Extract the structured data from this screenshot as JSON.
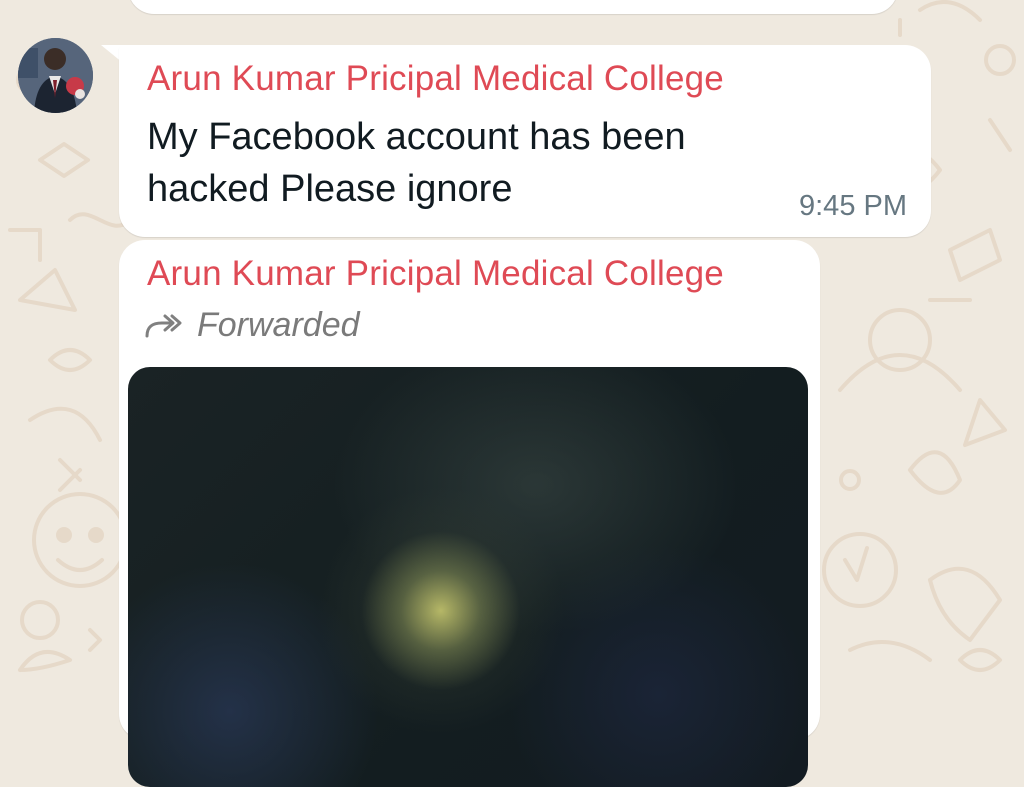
{
  "theme": {
    "wallpaper_color": "#efe9df",
    "bubble_color": "#ffffff",
    "sender_color": "#df4a55",
    "text_color": "#111b21",
    "timestamp_color": "#667781"
  },
  "messages": [
    {
      "sender": "Arun Kumar Pricipal Medical College",
      "text": "My Facebook account has been hacked Please ignore",
      "time": "9:45 PM"
    },
    {
      "sender": "Arun Kumar Pricipal Medical College",
      "forwarded_label": "Forwarded",
      "forwarded_icon": "forward-arrow-icon",
      "media": "blurred-image-placeholder"
    }
  ]
}
